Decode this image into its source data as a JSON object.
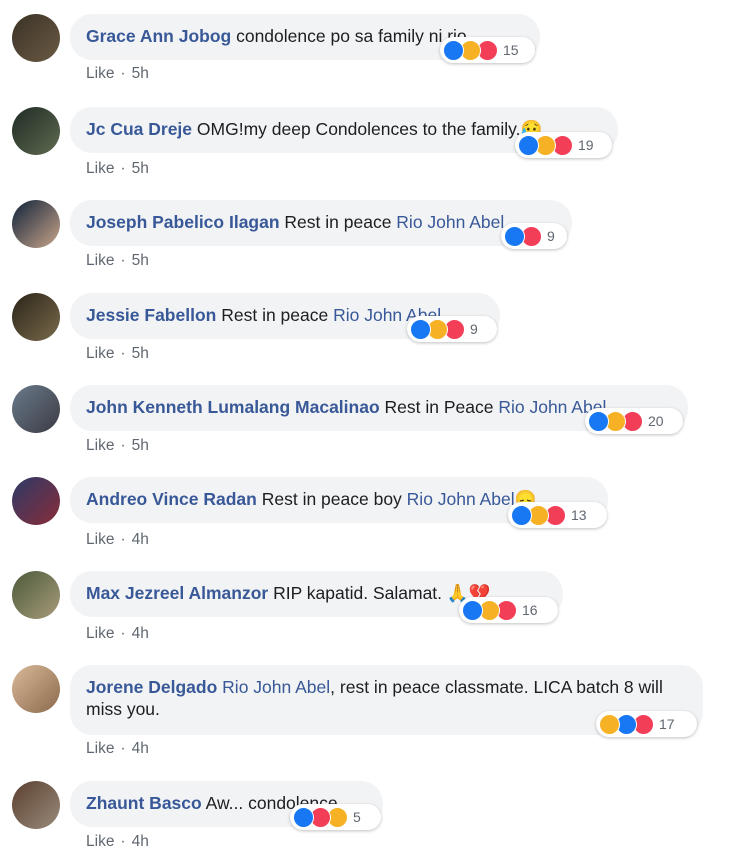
{
  "comments": [
    {
      "author": "Grace Ann Jobog",
      "parts": [
        {
          "t": "condolence po sa family ni rio..",
          "m": false
        }
      ],
      "time": "5h",
      "reactions": [
        "like",
        "sad",
        "love"
      ],
      "count": "15",
      "avatar": [
        "#3a3226",
        "#6b5a44"
      ]
    },
    {
      "author": "Jc Cua Dreje",
      "parts": [
        {
          "t": "OMG!my deep Condolences to the family.😥",
          "m": false
        }
      ],
      "time": "5h",
      "reactions": [
        "like",
        "sad",
        "love"
      ],
      "count": "19",
      "avatar": [
        "#1f2b24",
        "#5f6b50"
      ]
    },
    {
      "author": "Joseph Pabelico Ilagan",
      "parts": [
        {
          "t": "Rest in peace ",
          "m": false
        },
        {
          "t": "Rio John Abel",
          "m": true
        }
      ],
      "time": "5h",
      "reactions": [
        "like",
        "love"
      ],
      "count": "9",
      "avatar": [
        "#10223a",
        "#c9a58a"
      ]
    },
    {
      "author": "Jessie Fabellon",
      "parts": [
        {
          "t": "Rest in peace ",
          "m": false
        },
        {
          "t": "Rio John Abel",
          "m": true
        }
      ],
      "time": "5h",
      "reactions": [
        "like",
        "sad",
        "love"
      ],
      "count": "9",
      "avatar": [
        "#2a2418",
        "#7a6a4c"
      ]
    },
    {
      "author": "John Kenneth Lumalang Macalinao",
      "parts": [
        {
          "t": "Rest in Peace ",
          "m": false
        },
        {
          "t": "Rio John Abel",
          "m": true
        }
      ],
      "time": "5h",
      "reactions": [
        "like",
        "sad",
        "love"
      ],
      "count": "20",
      "avatar": [
        "#6a7a8a",
        "#3b3b44"
      ]
    },
    {
      "author": "Andreo Vince Radan",
      "parts": [
        {
          "t": "Rest in peace boy ",
          "m": false
        },
        {
          "t": "Rio John Abel",
          "m": true
        },
        {
          "t": "😞",
          "m": false
        }
      ],
      "time": "4h",
      "reactions": [
        "like",
        "sad",
        "love"
      ],
      "count": "13",
      "avatar": [
        "#2b3a66",
        "#8a2c3a"
      ]
    },
    {
      "author": "Max Jezreel Almanzor",
      "parts": [
        {
          "t": "RIP kapatid. Salamat. 🙏💔",
          "m": false
        }
      ],
      "time": "4h",
      "reactions": [
        "like",
        "sad",
        "love"
      ],
      "count": "16",
      "avatar": [
        "#4b5a3a",
        "#a89b7a"
      ]
    },
    {
      "author": "Jorene Delgado",
      "parts": [
        {
          "t": "Rio John Abel",
          "m": true
        },
        {
          "t": ", rest in peace classmate. LICA batch 8 will miss you.",
          "m": false
        }
      ],
      "time": "4h",
      "reactions": [
        "sad",
        "like",
        "love"
      ],
      "count": "17",
      "avatar": [
        "#d9b99a",
        "#8a6a4a"
      ]
    },
    {
      "author": "Zhaunt Basco",
      "parts": [
        {
          "t": "Aw... condolence",
          "m": false
        }
      ],
      "time": "4h",
      "reactions": [
        "like",
        "love",
        "sad"
      ],
      "count": "5",
      "avatar": [
        "#5a4030",
        "#9a8a7a"
      ]
    }
  ],
  "like_label": "Like"
}
